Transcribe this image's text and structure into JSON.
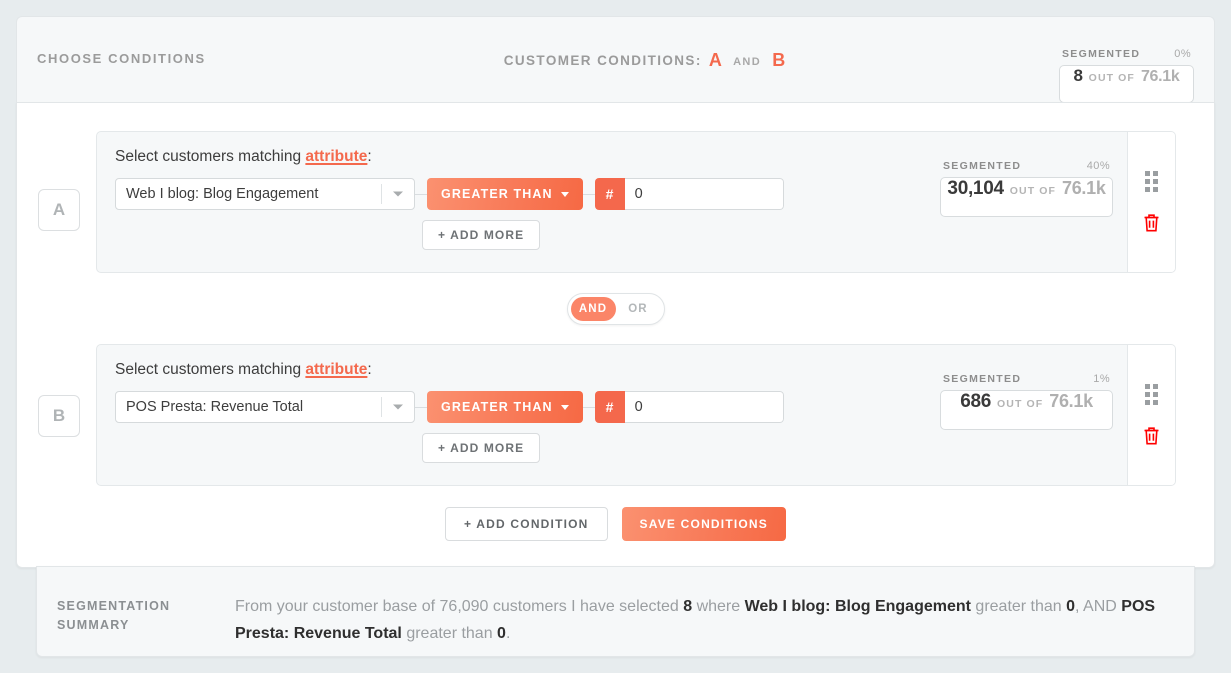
{
  "header": {
    "title": "CHOOSE CONDITIONS",
    "center_prefix": "CUSTOMER CONDITIONS:",
    "condition_a": "A",
    "and_word": "AND",
    "condition_b": "B",
    "meter": {
      "label": "SEGMENTED",
      "percent": "0%",
      "value": "8",
      "middle": "OUT OF",
      "total": "76.1k"
    }
  },
  "conditions": [
    {
      "badge": "A",
      "match_prefix": "Select customers matching ",
      "attribute_link": "attribute",
      "match_suffix": ":",
      "select_value": "Web I blog: Blog Engagement",
      "operator": "GREATER THAN",
      "value_prefix": "#",
      "value": "0",
      "add_more": "+ ADD MORE",
      "meter": {
        "label": "SEGMENTED",
        "percent": "40%",
        "value": "30,104",
        "middle": "OUT OF",
        "total": "76.1k"
      },
      "drag_handle_icon": "drag-handle-icon",
      "delete_icon": "trash-icon"
    },
    {
      "badge": "B",
      "match_prefix": "Select customers matching ",
      "attribute_link": "attribute",
      "match_suffix": ":",
      "select_value": "POS Presta: Revenue Total",
      "operator": "GREATER THAN",
      "value_prefix": "#",
      "value": "0",
      "add_more": "+ ADD MORE",
      "meter": {
        "label": "SEGMENTED",
        "percent": "1%",
        "value": "686",
        "middle": "OUT OF",
        "total": "76.1k"
      },
      "drag_handle_icon": "drag-handle-icon",
      "delete_icon": "trash-icon"
    }
  ],
  "logic_toggle": {
    "and_label": "AND",
    "or_label": "OR",
    "selected": "AND"
  },
  "footer": {
    "add_condition_label": "+ ADD CONDITION",
    "save_conditions_label": "SAVE CONDITIONS"
  },
  "summary": {
    "label_line1": "SEGMENTATION",
    "label_line2": "SUMMARY",
    "part1": "From your customer base of 76,090 customers I have selected ",
    "selected_count": "8",
    "part2": " where ",
    "attribute_a": "Web I blog: Blog Engagement",
    "part3": " greater than ",
    "value_a": "0",
    "part4": ", AND ",
    "attribute_b": "POS Presta: Revenue Total",
    "part5": " greater than ",
    "value_b": "0",
    "part6": "."
  },
  "colors": {
    "accent": "#f4694d",
    "accent_light": "#fb9170",
    "danger": "#ff0000",
    "page_bg": "#e7ecee",
    "card_bg": "#f6f8f9"
  }
}
